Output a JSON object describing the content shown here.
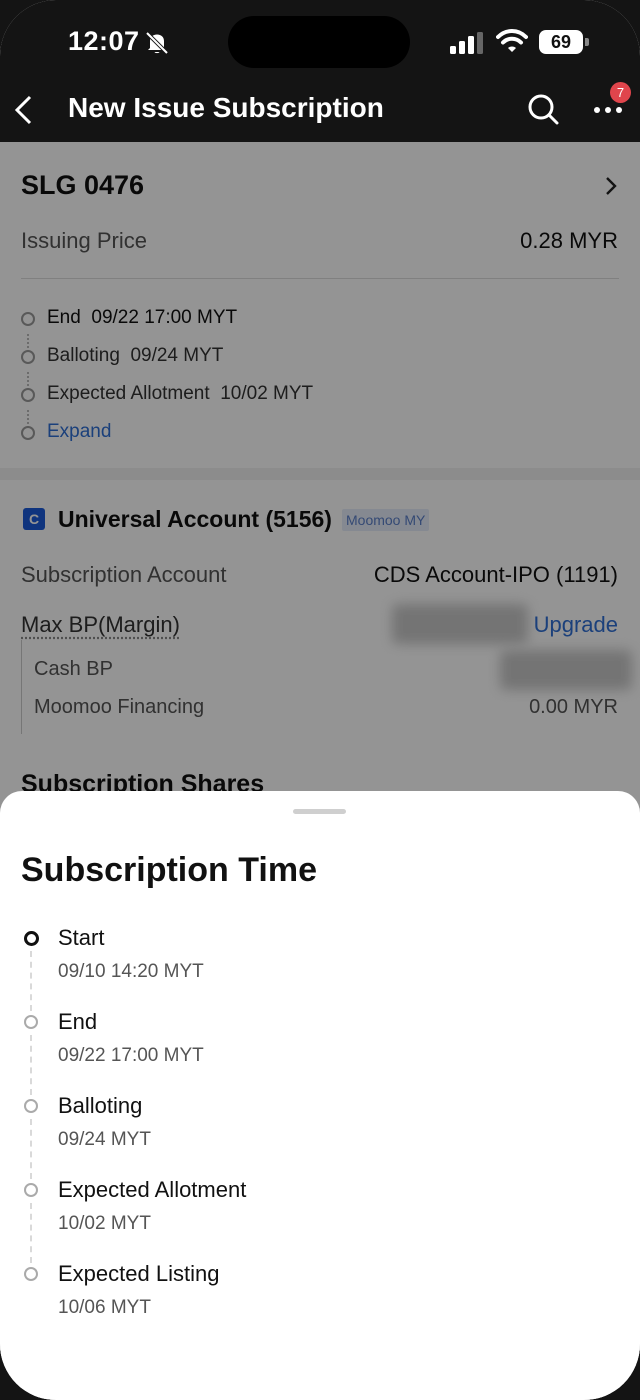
{
  "status_bar": {
    "time": "12:07",
    "battery": "69"
  },
  "header": {
    "title": "New Issue Subscription",
    "notification_count": "7"
  },
  "stock": {
    "code": "SLG 0476",
    "price_label": "Issuing Price",
    "price_value": "0.28 MYR",
    "timeline": [
      {
        "label": "End",
        "value": "09/22 17:00 MYT"
      },
      {
        "label": "Balloting",
        "value": "09/24 MYT"
      },
      {
        "label": "Expected Allotment",
        "value": "10/02 MYT"
      }
    ],
    "expand_label": "Expand"
  },
  "account": {
    "name": "Universal Account (5156)",
    "tag": "Moomoo MY",
    "icon_letter": "C",
    "sub_account_label": "Subscription Account",
    "sub_account_value": "CDS Account-IPO (1191)",
    "max_bp_label": "Max BP(Margin)",
    "upgrade_label": "Upgrade",
    "cash_bp_label": "Cash BP",
    "financing_label": "Moomoo Financing",
    "financing_value": "0.00 MYR",
    "shares_heading": "Subscription Shares"
  },
  "sheet": {
    "title": "Subscription Time",
    "items": [
      {
        "title": "Start",
        "time": "09/10 14:20 MYT"
      },
      {
        "title": "End",
        "time": "09/22 17:00 MYT"
      },
      {
        "title": "Balloting",
        "time": "09/24 MYT"
      },
      {
        "title": "Expected Allotment",
        "time": "10/02 MYT"
      },
      {
        "title": "Expected Listing",
        "time": "10/06 MYT"
      }
    ]
  }
}
